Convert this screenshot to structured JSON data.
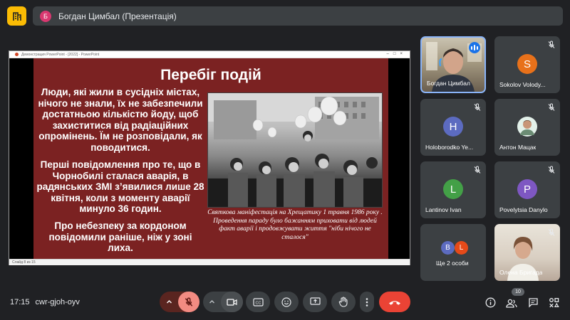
{
  "header": {
    "presenter_initial": "Б",
    "title": "Богдан Цимбал (Презентація)"
  },
  "powerpoint": {
    "window_title": "Демонстрация PowerPoint - [2022] - PowerPoint",
    "status": "Слайд 8 из 15"
  },
  "slide": {
    "title": "Перебіг подій",
    "paragraph1": "Люди, які жили в сусідніх містах, нічого не знали, їх не забезпечили достатньою кількістю йоду, щоб захиститися від радіаційних опромінень. Їм не розповідали, як поводитися.",
    "paragraph2": "Перші повідомлення про те, що в Чорнобилі сталася аварія, в радянських ЗМІ з’явилися лише 28 квітня, коли з моменту аварії минуло 36 годин.",
    "paragraph3": "Про небезпеку за кордоном повідомили раніше, ніж у зоні лиха.",
    "caption": "Святкова маніфестація на Хрещатику 1 травня 1986 року . Проведення параду було бажанням приховати від людей факт аварії і продовжувати життя \"ніби нічого не сталося\""
  },
  "participants": [
    {
      "name": "Богдан Цимбал"
    },
    {
      "name": "Sokolov Volody...",
      "initial": "S",
      "color": "#e8711a"
    },
    {
      "name": "Holoborodko Ye...",
      "initial": "H",
      "color": "#5c6bc0"
    },
    {
      "name": "Антон Мацак"
    },
    {
      "name": "Lantinov Ivan",
      "initial": "L",
      "color": "#43a047"
    },
    {
      "name": "Povelytsia Danylo",
      "initial": "P",
      "color": "#7e57c2"
    },
    {
      "name": "Ще 2 особи",
      "initials": [
        "B",
        "L"
      ],
      "colors": [
        "#5c6bc0",
        "#e64a19"
      ]
    },
    {
      "name": "Олена Бригада"
    }
  ],
  "bottom": {
    "time": "17:15",
    "meeting_code": "cwr-gjoh-oyv",
    "participant_count": "10"
  }
}
